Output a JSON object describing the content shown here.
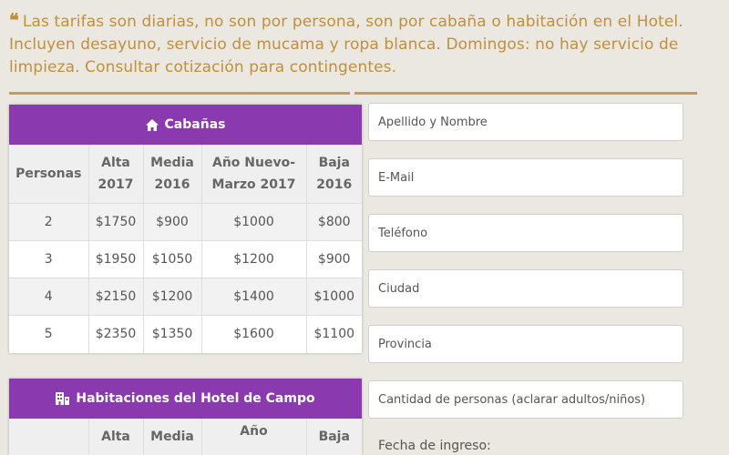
{
  "notice": {
    "quote_mark": "❝",
    "text": "Las tarifas son diarias, no son por persona, son por cabaña o habitación en el Hotel. Incluyen desayuno, servicio de mucama y ropa blanca. Domingos: no hay servicio de limpieza. Consultar cotización para contingentes."
  },
  "cabanas": {
    "title": "Cabañas",
    "icon": "home-icon",
    "columns": [
      "Personas",
      "Alta 2017",
      "Media 2016",
      "Año Nuevo-Marzo 2017",
      "Baja 2016"
    ],
    "rows": [
      [
        "2",
        "$1750",
        "$900",
        "$1000",
        "$800"
      ],
      [
        "3",
        "$1950",
        "$1050",
        "$1200",
        "$900"
      ],
      [
        "4",
        "$2150",
        "$1200",
        "$1400",
        "$1000"
      ],
      [
        "5",
        "$2350",
        "$1350",
        "$1600",
        "$1100"
      ]
    ]
  },
  "hotel": {
    "title": "Habitaciones del Hotel de Campo",
    "icon": "building-icon",
    "columns": [
      "",
      "Alta",
      "Media",
      "Año",
      "Baja"
    ]
  },
  "form": {
    "fields": [
      {
        "placeholder": "Apellido y Nombre"
      },
      {
        "placeholder": "E-Mail"
      },
      {
        "placeholder": "Teléfono"
      },
      {
        "placeholder": "Ciudad"
      },
      {
        "placeholder": "Provincia"
      },
      {
        "placeholder": "Cantidad de personas (aclarar adultos/niños)"
      }
    ],
    "date_label": "Fecha de ingreso:"
  },
  "colors": {
    "accent": "#8a3aae",
    "gold": "#c28f3c",
    "background": "#eae8e1"
  }
}
